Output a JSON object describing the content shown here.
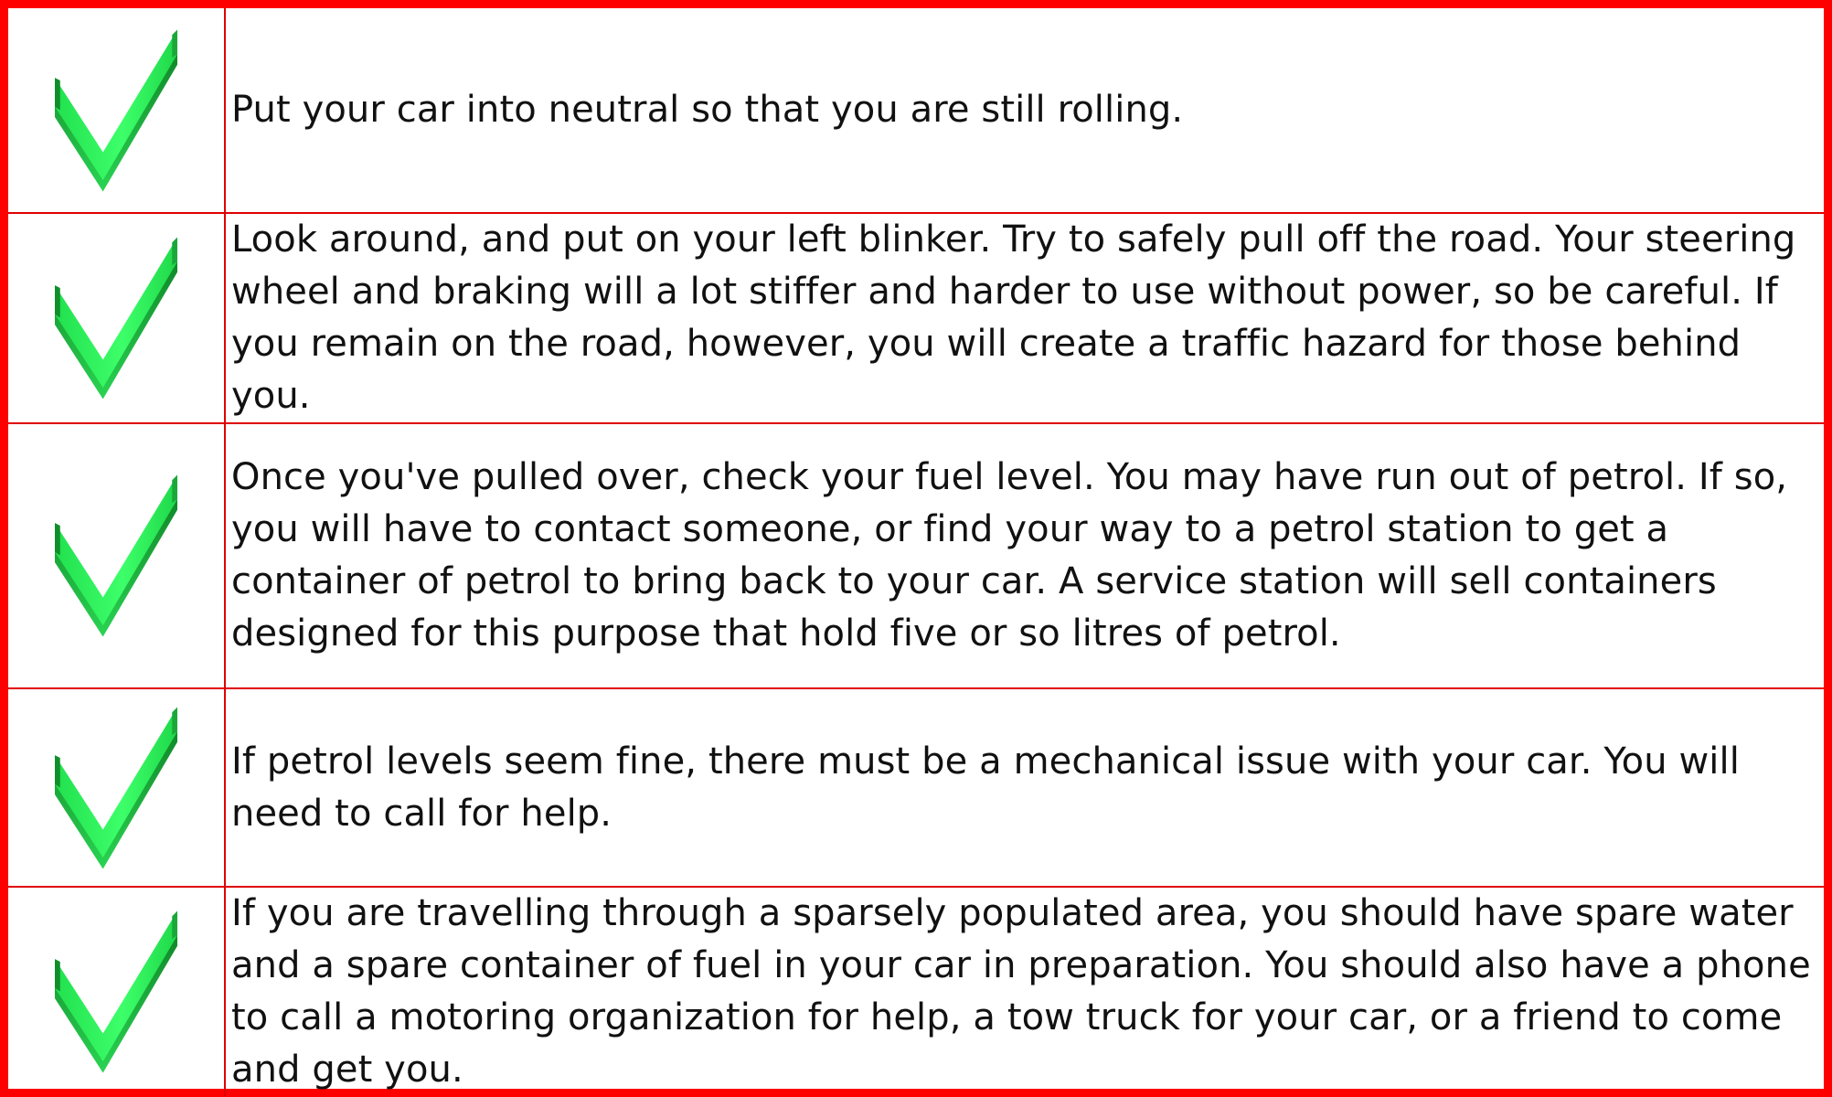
{
  "steps": [
    {
      "icon": "green-checkmark-icon",
      "text": "Put your car into neutral so that you are still rolling."
    },
    {
      "icon": "green-checkmark-icon",
      "text": "Look around, and put on your left blinker. Try to safely pull off the road. Your steering wheel and braking will a lot stiffer and harder to use without power, so be careful. If you remain on the road, however, you will create a traffic hazard for those behind you."
    },
    {
      "icon": "green-checkmark-icon",
      "text": "Once you've pulled over, check your fuel level. You may have run out of petrol. If so, you will have to contact someone, or find your way to a petrol station to get a container of petrol to bring back to your car. A service station will sell containers designed for this purpose that hold five or so litres of petrol."
    },
    {
      "icon": "green-checkmark-icon",
      "text": "If petrol levels seem fine, there must be a mechanical issue with your car. You will need to call for help."
    },
    {
      "icon": "green-checkmark-icon",
      "text": "If you are travelling through a sparsely populated area, you should have spare water and a spare container of fuel in your car in preparation. You should also have a phone to call a motoring organization for help, a tow truck for your car, or a friend to come and get you."
    }
  ],
  "colors": {
    "border": "#ff0000",
    "check_light": "#3dff6a",
    "check_dark": "#0a9a2a"
  }
}
